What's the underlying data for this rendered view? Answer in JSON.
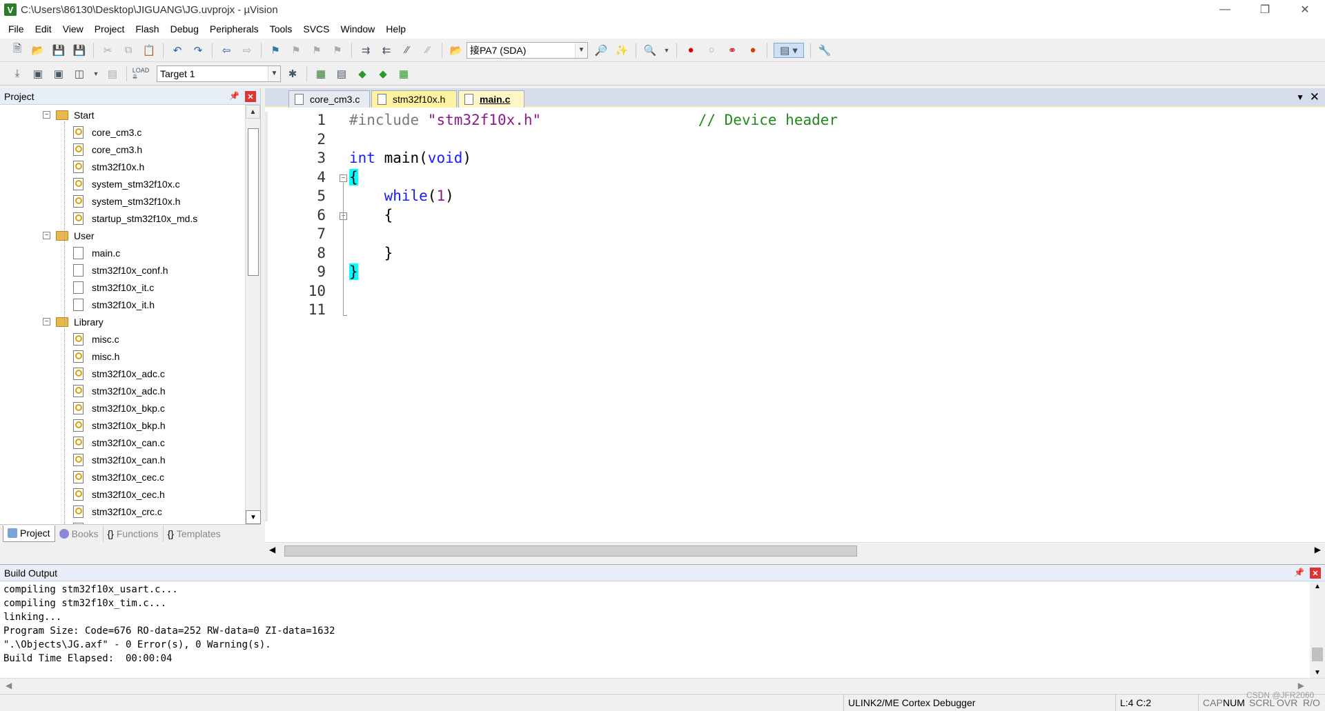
{
  "window": {
    "title": "C:\\Users\\86130\\Desktop\\JIGUANG\\JG.uvprojx - µVision",
    "app_icon": "V"
  },
  "menu": [
    "File",
    "Edit",
    "View",
    "Project",
    "Flash",
    "Debug",
    "Peripherals",
    "Tools",
    "SVCS",
    "Window",
    "Help"
  ],
  "toolbar1": {
    "combo_value": "接PA7 (SDA)"
  },
  "toolbar2": {
    "target": "Target 1"
  },
  "project_panel": {
    "title": "Project",
    "tree": [
      {
        "kind": "group",
        "label": "Start"
      },
      {
        "kind": "file",
        "label": "core_cm3.c",
        "key": true
      },
      {
        "kind": "file",
        "label": "core_cm3.h",
        "key": true
      },
      {
        "kind": "file",
        "label": "stm32f10x.h",
        "key": true
      },
      {
        "kind": "file",
        "label": "system_stm32f10x.c",
        "key": true
      },
      {
        "kind": "file",
        "label": "system_stm32f10x.h",
        "key": true
      },
      {
        "kind": "file",
        "label": "startup_stm32f10x_md.s",
        "key": true
      },
      {
        "kind": "group",
        "label": "User"
      },
      {
        "kind": "file",
        "label": "main.c",
        "key": false
      },
      {
        "kind": "file",
        "label": "stm32f10x_conf.h",
        "key": false
      },
      {
        "kind": "file",
        "label": "stm32f10x_it.c",
        "key": false
      },
      {
        "kind": "file",
        "label": "stm32f10x_it.h",
        "key": false
      },
      {
        "kind": "group",
        "label": "Library"
      },
      {
        "kind": "file",
        "label": "misc.c",
        "key": true
      },
      {
        "kind": "file",
        "label": "misc.h",
        "key": true
      },
      {
        "kind": "file",
        "label": "stm32f10x_adc.c",
        "key": true
      },
      {
        "kind": "file",
        "label": "stm32f10x_adc.h",
        "key": true
      },
      {
        "kind": "file",
        "label": "stm32f10x_bkp.c",
        "key": true
      },
      {
        "kind": "file",
        "label": "stm32f10x_bkp.h",
        "key": true
      },
      {
        "kind": "file",
        "label": "stm32f10x_can.c",
        "key": true
      },
      {
        "kind": "file",
        "label": "stm32f10x_can.h",
        "key": true
      },
      {
        "kind": "file",
        "label": "stm32f10x_cec.c",
        "key": true
      },
      {
        "kind": "file",
        "label": "stm32f10x_cec.h",
        "key": true
      },
      {
        "kind": "file",
        "label": "stm32f10x_crc.c",
        "key": true
      },
      {
        "kind": "file",
        "label": "stm32f10x_crc.h",
        "key": true
      }
    ],
    "tabs": [
      "Project",
      "Books",
      "Functions",
      "Templates"
    ],
    "active_tab": "Project"
  },
  "editor": {
    "tabs": [
      "core_cm3.c",
      "stm32f10x.h",
      "main.c"
    ],
    "active_tab": "main.c",
    "line_numbers": [
      "1",
      "2",
      "3",
      "4",
      "5",
      "6",
      "7",
      "8",
      "9",
      "10",
      "11"
    ],
    "lines": [
      [
        {
          "t": "#include ",
          "c": "pp"
        },
        {
          "t": "\"stm32f10x.h\"",
          "c": "str"
        },
        {
          "t": "                  ",
          "c": ""
        },
        {
          "t": "// Device header",
          "c": "cmt"
        }
      ],
      [],
      [
        {
          "t": "int",
          "c": "kw"
        },
        {
          "t": " main(",
          "c": ""
        },
        {
          "t": "void",
          "c": "kw"
        },
        {
          "t": ")",
          "c": ""
        }
      ],
      [
        {
          "t": "{",
          "c": "br"
        }
      ],
      [
        {
          "t": "    ",
          "c": ""
        },
        {
          "t": "while",
          "c": "kw"
        },
        {
          "t": "(",
          "c": ""
        },
        {
          "t": "1",
          "c": "num"
        },
        {
          "t": ")",
          "c": ""
        }
      ],
      [
        {
          "t": "    {",
          "c": ""
        }
      ],
      [],
      [
        {
          "t": "    }",
          "c": ""
        }
      ],
      [
        {
          "t": "}",
          "c": "br"
        }
      ],
      [],
      []
    ]
  },
  "build_output": {
    "title": "Build Output",
    "lines": [
      "compiling stm32f10x_usart.c...",
      "compiling stm32f10x_tim.c...",
      "linking...",
      "Program Size: Code=676 RO-data=252 RW-data=0 ZI-data=1632",
      "\".\\Objects\\JG.axf\" - 0 Error(s), 0 Warning(s).",
      "Build Time Elapsed:  00:00:04"
    ]
  },
  "statusbar": {
    "debugger": "ULINK2/ME Cortex Debugger",
    "position": "L:4 C:2",
    "cap": "CAP",
    "num": "NUM",
    "scrl": "SCRL",
    "ovr": "OVR",
    "rw": "R/O",
    "watermark": "CSDN @JFR2060"
  }
}
